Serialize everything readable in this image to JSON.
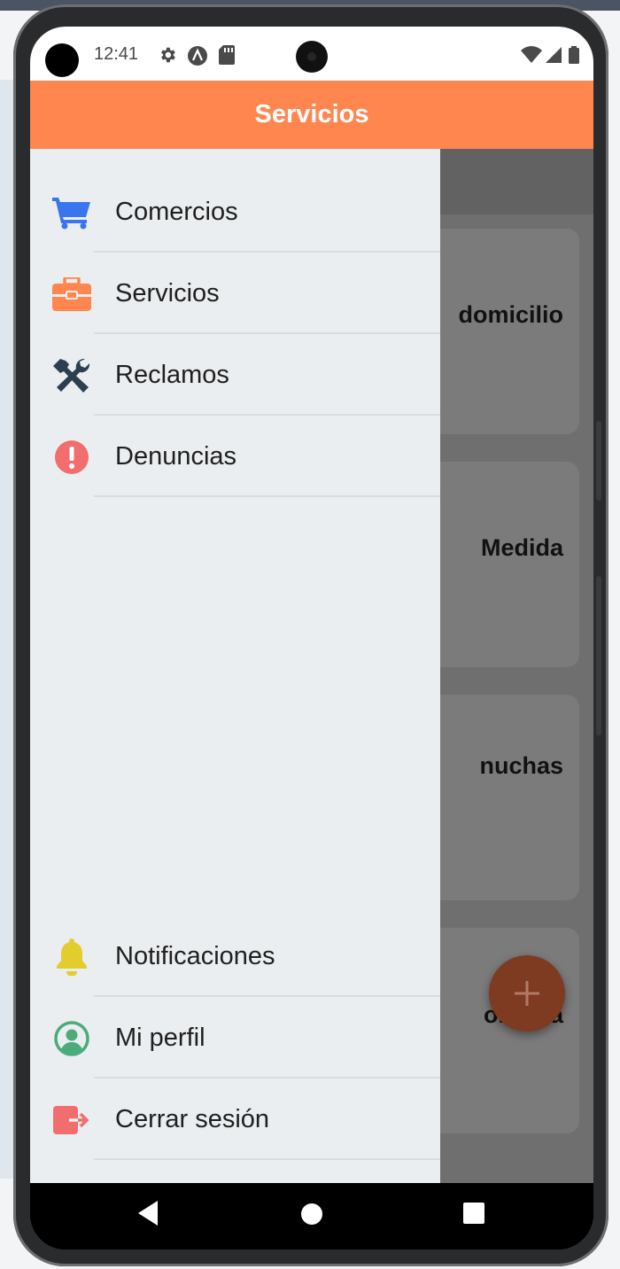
{
  "status_bar": {
    "time": "12:41",
    "left_icons": [
      "gear-icon",
      "a-circle-icon",
      "sd-card-icon"
    ],
    "right_icons": [
      "wifi-icon",
      "cell-signal-icon",
      "battery-icon"
    ]
  },
  "header": {
    "title": "Servicios"
  },
  "drawer": {
    "top_items": [
      {
        "label": "Comercios",
        "icon": "cart-icon",
        "color": "#3a75f0"
      },
      {
        "label": "Servicios",
        "icon": "toolbox-icon",
        "color": "#ff864f"
      },
      {
        "label": "Reclamos",
        "icon": "tools-icon",
        "color": "#2c3e50"
      },
      {
        "label": "Denuncias",
        "icon": "exclamation-circle-icon",
        "color": "#f26d6d"
      }
    ],
    "bottom_items": [
      {
        "label": "Notificaciones",
        "icon": "bell-icon",
        "color": "#e3cd2d"
      },
      {
        "label": "Mi perfil",
        "icon": "user-circle-icon",
        "color": "#4bac7a"
      },
      {
        "label": "Cerrar sesión",
        "icon": "sign-out-icon",
        "color": "#f26d6d"
      }
    ]
  },
  "background_cards": [
    {
      "title": "domicilio"
    },
    {
      "title": "Medida"
    },
    {
      "title": "nuchas"
    },
    {
      "title": "orueba"
    }
  ],
  "fab": {
    "icon": "plus-icon"
  },
  "nav_bar": {
    "icons": [
      "back-icon",
      "home-icon",
      "recents-icon"
    ]
  },
  "colors": {
    "accent": "#ff864f",
    "drawer_bg": "#ebeef0"
  }
}
